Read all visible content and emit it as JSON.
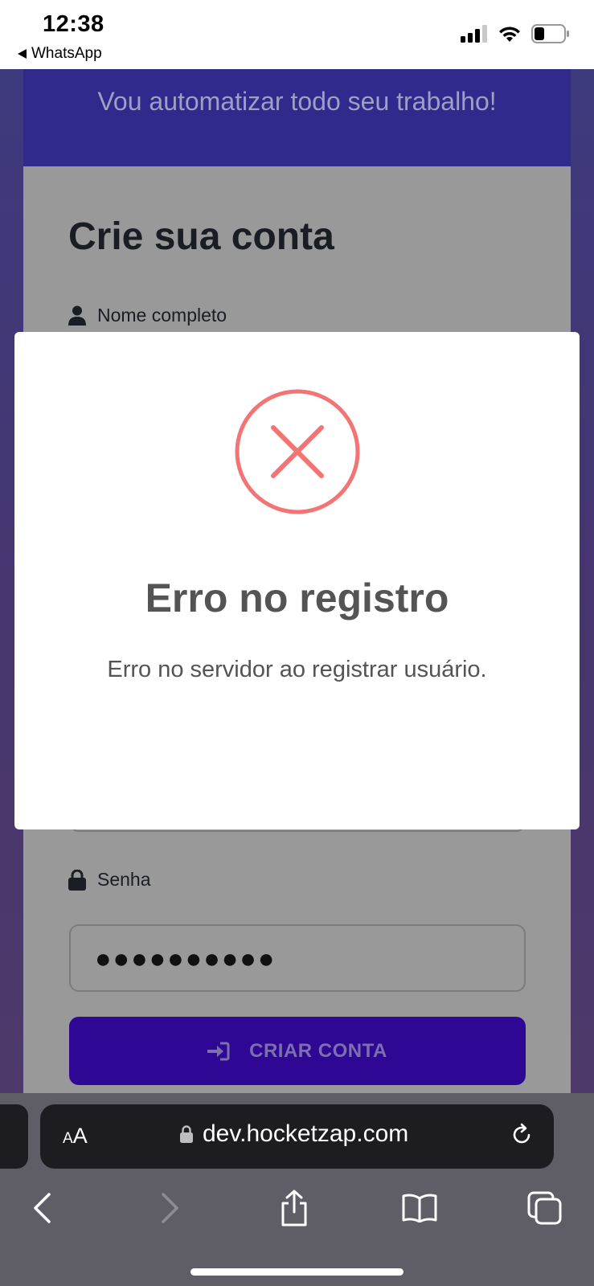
{
  "status_bar": {
    "time": "12:38",
    "back_app": "WhatsApp"
  },
  "page": {
    "hero_text": "Vou automatizar todo seu trabalho!",
    "card_title": "Crie sua conta",
    "name_label": "Nome completo",
    "password_label": "Senha",
    "password_value": "●●●●●●●●●●",
    "submit_label": "CRIAR CONTA"
  },
  "modal": {
    "title": "Erro no registro",
    "message": "Erro no servidor ao registrar usuário.",
    "icon": "error-x-icon",
    "icon_color": "#f27474"
  },
  "browser": {
    "aa_small": "A",
    "aa_large": "A",
    "url": "dev.hocketzap.com"
  },
  "colors": {
    "hero_bg": "#2f2a8c",
    "button_bg": "#2f0795"
  }
}
